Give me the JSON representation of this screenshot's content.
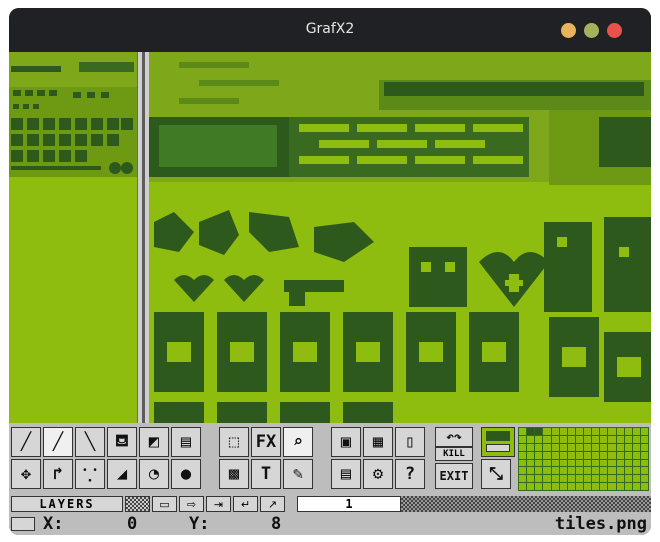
{
  "window": {
    "title": "GrafX2"
  },
  "toolbar": {
    "tools_row1": [
      {
        "name": "freehand-draw-tool",
        "glyph": "╱"
      },
      {
        "name": "continuous-draw-tool",
        "glyph": "╱"
      },
      {
        "name": "line-tool",
        "glyph": "╲"
      },
      {
        "name": "fill-tool",
        "glyph": "⛾"
      },
      {
        "name": "rectangle-tool",
        "glyph": "◩"
      },
      {
        "name": "gradient-rect-tool",
        "glyph": "▤"
      },
      {
        "name": "brush-grab-tool",
        "glyph": "⬚"
      },
      {
        "name": "effects-tool",
        "glyph": "FX"
      },
      {
        "name": "magnifier-tool",
        "glyph": "🔍"
      },
      {
        "name": "screen-tool",
        "glyph": "▣"
      },
      {
        "name": "image-settings-tool",
        "glyph": "▦"
      },
      {
        "name": "new-page-tool",
        "glyph": "🗋"
      },
      {
        "name": "undo-redo-tool",
        "glyph": "↶↷"
      }
    ],
    "tools_row2": [
      {
        "name": "move-tool",
        "glyph": "✥"
      },
      {
        "name": "curve-tool",
        "glyph": "↱"
      },
      {
        "name": "spray-tool",
        "glyph": "⸪"
      },
      {
        "name": "polygon-tool",
        "glyph": "◢"
      },
      {
        "name": "ellipse-tool",
        "glyph": "◔"
      },
      {
        "name": "sphere-tool",
        "glyph": "●"
      },
      {
        "name": "brush-effects-tool",
        "glyph": "▩"
      },
      {
        "name": "text-tool",
        "glyph": "T"
      },
      {
        "name": "color-picker-tool",
        "glyph": "✎"
      },
      {
        "name": "save-tool",
        "glyph": "▤"
      },
      {
        "name": "settings-tool",
        "glyph": "⚙"
      },
      {
        "name": "help-tool",
        "glyph": "?"
      },
      {
        "name": "exit-tool",
        "glyph": "EXIT"
      }
    ],
    "kill_label": "KILL",
    "exit_label": "EXIT",
    "fx_label": "FX"
  },
  "layers": {
    "label": "LAYERS",
    "current_layer": "1"
  },
  "status": {
    "x_label": "X:",
    "x_value": "0",
    "y_label": "Y:",
    "y_value": "8",
    "filename": "tiles.png"
  },
  "colors": {
    "light_green": "#8ebc0f",
    "dark_green": "#2d5a1c",
    "ui_gray": "#bdbdbd"
  }
}
